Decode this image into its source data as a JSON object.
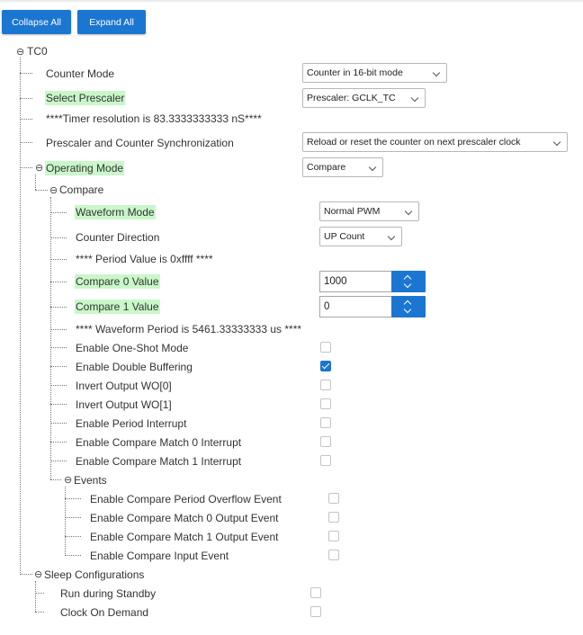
{
  "toolbar": {
    "collapse_all": "Collapse All",
    "expand_all": "Expand All"
  },
  "tree": {
    "root": "TC0",
    "counter_mode": {
      "label": "Counter Mode",
      "value": "Counter in 16-bit mode"
    },
    "select_prescaler": {
      "label": "Select Prescaler",
      "value": "Prescaler: GCLK_TC"
    },
    "timer_resolution": "****Timer resolution is 83.3333333333 nS****",
    "prescaler_sync": {
      "label": "Prescaler and Counter Synchronization",
      "value": "Reload or reset the counter on next prescaler clock"
    },
    "operating_mode": {
      "label": "Operating Mode",
      "value": "Compare"
    },
    "compare": {
      "label": "Compare",
      "waveform_mode": {
        "label": "Waveform Mode",
        "value": "Normal PWM"
      },
      "counter_direction": {
        "label": "Counter Direction",
        "value": "UP Count"
      },
      "period_value": "**** Period Value is 0xffff ****",
      "compare0": {
        "label": "Compare 0 Value",
        "value": "1000"
      },
      "compare1": {
        "label": "Compare 1 Value",
        "value": "0"
      },
      "waveform_period": "**** Waveform Period is 5461.33333333 us ****",
      "options": [
        {
          "label": "Enable One-Shot Mode",
          "checked": false
        },
        {
          "label": "Enable Double Buffering",
          "checked": true
        },
        {
          "label": "Invert Output WO[0]",
          "checked": false
        },
        {
          "label": "Invert Output WO[1]",
          "checked": false
        },
        {
          "label": "Enable Period Interrupt",
          "checked": false
        },
        {
          "label": "Enable Compare Match 0 Interrupt",
          "checked": false
        },
        {
          "label": "Enable Compare Match 1 Interrupt",
          "checked": false
        }
      ],
      "events": {
        "label": "Events",
        "options": [
          {
            "label": "Enable Compare Period Overflow Event",
            "checked": false
          },
          {
            "label": "Enable Compare Match 0 Output Event",
            "checked": false
          },
          {
            "label": "Enable Compare Match 1 Output Event",
            "checked": false
          },
          {
            "label": "Enable Compare Input Event",
            "checked": false
          }
        ]
      }
    },
    "sleep": {
      "label": "Sleep Configurations",
      "options": [
        {
          "label": "Run during Standby",
          "checked": false
        },
        {
          "label": "Clock On Demand",
          "checked": false
        }
      ]
    }
  },
  "icons": {
    "collapse": "⊖"
  },
  "colors": {
    "accent": "#1b76d2",
    "highlight": "#c9f7c9"
  }
}
